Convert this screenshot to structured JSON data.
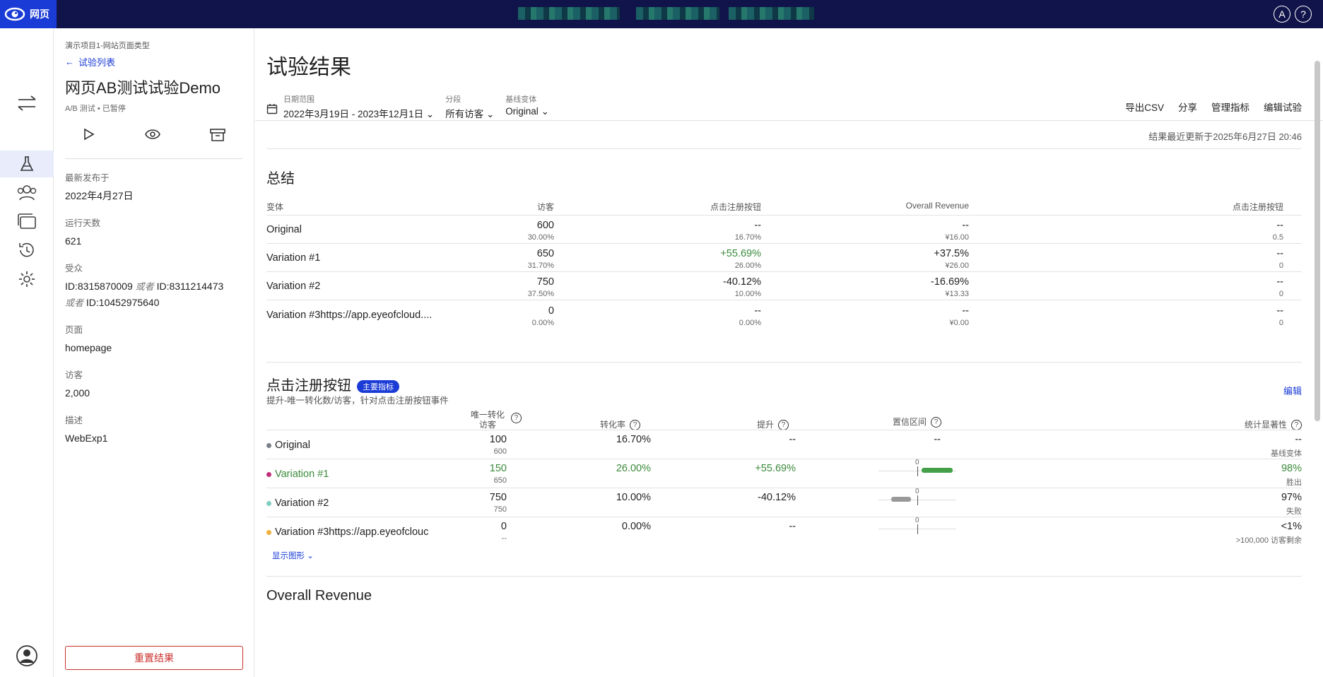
{
  "app": {
    "brand": "网页"
  },
  "sidebar": {
    "breadcrumb": "演示项目1-网站页面类型",
    "back_label": "试验列表",
    "title": "网页AB测试试验Demo",
    "type": "A/B 测试",
    "status": "已暂停",
    "fields": [
      {
        "label": "最新发布于",
        "value": "2022年4月27日"
      },
      {
        "label": "运行天数",
        "value": "621"
      },
      {
        "label": "页面",
        "value": "homepage"
      },
      {
        "label": "访客",
        "value": "2,000"
      },
      {
        "label": "描述",
        "value": "WebExp1"
      }
    ],
    "audience_label": "受众",
    "audience": {
      "id1": "ID:8315870009",
      "or1": "或者",
      "id2": "ID:8311214473",
      "or2": "或者",
      "id3": "ID:10452975640"
    },
    "reset_label": "重置结果"
  },
  "header": {
    "title": "试验结果",
    "filters": [
      {
        "label": "日期范围",
        "value": "2022年3月19日 - 2023年12月1日"
      },
      {
        "label": "分段",
        "value": "所有访客"
      },
      {
        "label": "基线变体",
        "value": "Original"
      }
    ],
    "links": [
      "导出CSV",
      "分享",
      "管理指标",
      "编辑试验"
    ],
    "updated": "结果最近更新于2025年6月27日 20:46"
  },
  "summary": {
    "title": "总结",
    "headers": [
      "变体",
      "访客",
      "点击注册按钮",
      "Overall Revenue",
      "点击注册按钮"
    ],
    "rows": [
      {
        "name": "Original",
        "visitors": "600",
        "visitors_pct": "30.00%",
        "m1": "--",
        "m1_sub": "16.70%",
        "m2": "--",
        "m2_sub": "¥16.00",
        "m3": "--",
        "m3_sub": "0.5"
      },
      {
        "name": "Variation #1",
        "visitors": "650",
        "visitors_pct": "31.70%",
        "m1": "+55.69%",
        "m1_sub": "26.00%",
        "m2": "+37.5%",
        "m2_sub": "¥26.00",
        "m3": "--",
        "m3_sub": "0"
      },
      {
        "name": "Variation #2",
        "visitors": "750",
        "visitors_pct": "37.50%",
        "m1": "-40.12%",
        "m1_sub": "10.00%",
        "m2": "-16.69%",
        "m2_sub": "¥13.33",
        "m3": "--",
        "m3_sub": "0"
      },
      {
        "name": "Variation #3https://app.eyeofcloud....",
        "visitors": "0",
        "visitors_pct": "0.00%",
        "m1": "--",
        "m1_sub": "0.00%",
        "m2": "--",
        "m2_sub": "¥0.00",
        "m3": "--",
        "m3_sub": "0"
      }
    ]
  },
  "metric": {
    "title": "点击注册按钮",
    "badge": "主要指标",
    "desc": "提升-唯一转化数/访客，针对点击注册按钮事件",
    "edit_label": "编辑",
    "headers": {
      "conv1": "唯一转化",
      "conv2": "访客",
      "rate": "转化率",
      "lift": "提升",
      "ci": "置信区间",
      "sig": "统计显著性"
    },
    "ci_zero": "0",
    "rows": [
      {
        "name": "Original",
        "color": "#7a8088",
        "conv": "100",
        "vis": "600",
        "rate": "16.70%",
        "lift": "--",
        "ci": "--",
        "sig": "--",
        "sig_sub": "基线变体"
      },
      {
        "name": "Variation #1",
        "color": "#c0307a",
        "conv": "150",
        "vis": "650",
        "rate": "26.00%",
        "lift": "+55.69%",
        "ci": "",
        "sig": "98%",
        "sig_sub": "胜出"
      },
      {
        "name": "Variation #2",
        "color": "#7fcfc0",
        "conv": "750",
        "vis": "750",
        "rate": "10.00%",
        "lift": "-40.12%",
        "ci": "",
        "sig": "97%",
        "sig_sub": "失败"
      },
      {
        "name": "Variation #3https://app.eyeofclouc",
        "color": "#f0b040",
        "conv": "0",
        "vis": "--",
        "rate": "0.00%",
        "lift": "--",
        "ci": "",
        "sig": "<1%",
        "sig_sub": ">100,000 访客剩余"
      }
    ],
    "show_chart": "显示图形"
  },
  "next_section": {
    "title": "Overall Revenue"
  },
  "colors": {
    "brand": "#1a3bd6",
    "topbar": "#11144a",
    "positive": "#3a8a3a",
    "danger": "#c9302c"
  }
}
